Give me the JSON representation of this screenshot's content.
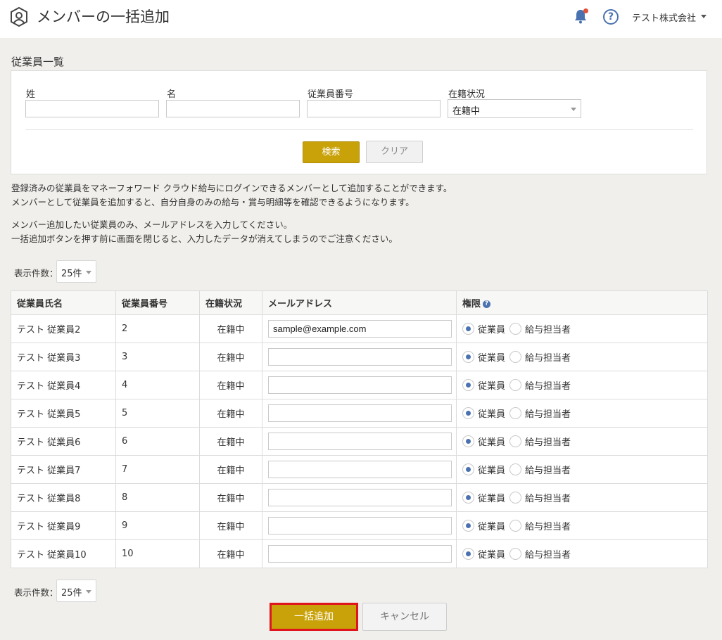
{
  "header": {
    "title": "メンバーの一括追加",
    "company": "テスト株式会社"
  },
  "search": {
    "section_title": "従業員一覧",
    "last_name_label": "姓",
    "first_name_label": "名",
    "employee_no_label": "従業員番号",
    "status_label": "在籍状況",
    "status_value": "在籍中",
    "search_button": "検索",
    "clear_button": "クリア"
  },
  "notice": {
    "line1": "登録済みの従業員をマネーフォワード クラウド給与にログインできるメンバーとして追加することができます。",
    "line2": "メンバーとして従業員を追加すると、自分自身のみの給与・賞与明細等を確認できるようになります。",
    "line3": "メンバー追加したい従業員のみ、メールアドレスを入力してください。",
    "line4": "一括追加ボタンを押す前に画面を閉じると、入力したデータが消えてしまうのでご注意ください。"
  },
  "pagination": {
    "label": "表示件数：",
    "value": "25件"
  },
  "table": {
    "headers": {
      "name": "従業員氏名",
      "number": "従業員番号",
      "status": "在籍状況",
      "email": "メールアドレス",
      "role": "権限"
    },
    "role_options": [
      "従業員",
      "給与担当者"
    ],
    "rows": [
      {
        "name": "テスト 従業員2",
        "number": "2",
        "status": "在籍中",
        "email": "sample@example.com",
        "role": "従業員"
      },
      {
        "name": "テスト 従業員3",
        "number": "3",
        "status": "在籍中",
        "email": "",
        "role": "従業員"
      },
      {
        "name": "テスト 従業員4",
        "number": "4",
        "status": "在籍中",
        "email": "",
        "role": "従業員"
      },
      {
        "name": "テスト 従業員5",
        "number": "5",
        "status": "在籍中",
        "email": "",
        "role": "従業員"
      },
      {
        "name": "テスト 従業員6",
        "number": "6",
        "status": "在籍中",
        "email": "",
        "role": "従業員"
      },
      {
        "name": "テスト 従業員7",
        "number": "7",
        "status": "在籍中",
        "email": "",
        "role": "従業員"
      },
      {
        "name": "テスト 従業員8",
        "number": "8",
        "status": "在籍中",
        "email": "",
        "role": "従業員"
      },
      {
        "name": "テスト 従業員9",
        "number": "9",
        "status": "在籍中",
        "email": "",
        "role": "従業員"
      },
      {
        "name": "テスト 従業員10",
        "number": "10",
        "status": "在籍中",
        "email": "",
        "role": "従業員"
      }
    ]
  },
  "actions": {
    "bulk_add": "一括追加",
    "cancel": "キャンセル"
  },
  "colors": {
    "accent_gold": "#c9a20a",
    "highlight_red": "#e0141d",
    "radio_blue": "#4a72b0"
  }
}
